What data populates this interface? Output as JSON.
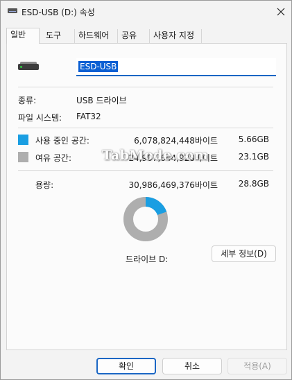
{
  "window": {
    "title": "ESD-USB (D:) 속성"
  },
  "tabs": [
    {
      "label": "일반",
      "active": true
    },
    {
      "label": "도구",
      "active": false
    },
    {
      "label": "하드웨어",
      "active": false
    },
    {
      "label": "공유",
      "active": false
    },
    {
      "label": "사용자 지정",
      "active": false
    }
  ],
  "general": {
    "drive_name": "ESD-USB",
    "type_label": "종류:",
    "type_value": "USB 드라이브",
    "fs_label": "파일 시스템:",
    "fs_value": "FAT32",
    "used": {
      "label": "사용 중인 공간:",
      "bytes": "6,078,824,448바이트",
      "size": "5.66GB",
      "color": "#1a9ee2"
    },
    "free": {
      "label": "여유 공간:",
      "bytes": "24,907,644,928바이트",
      "size": "23.1GB",
      "color": "#aeaeae"
    },
    "capacity": {
      "label": "용량:",
      "bytes": "30,986,469,376바이트",
      "size": "28.8GB"
    },
    "used_fraction": 0.196,
    "drive_caption": "드라이브 D:",
    "details_button": "세부 정보(D)"
  },
  "watermark": "TabMode.com",
  "buttons": {
    "ok": "확인",
    "cancel": "취소",
    "apply": "적용(A)"
  }
}
